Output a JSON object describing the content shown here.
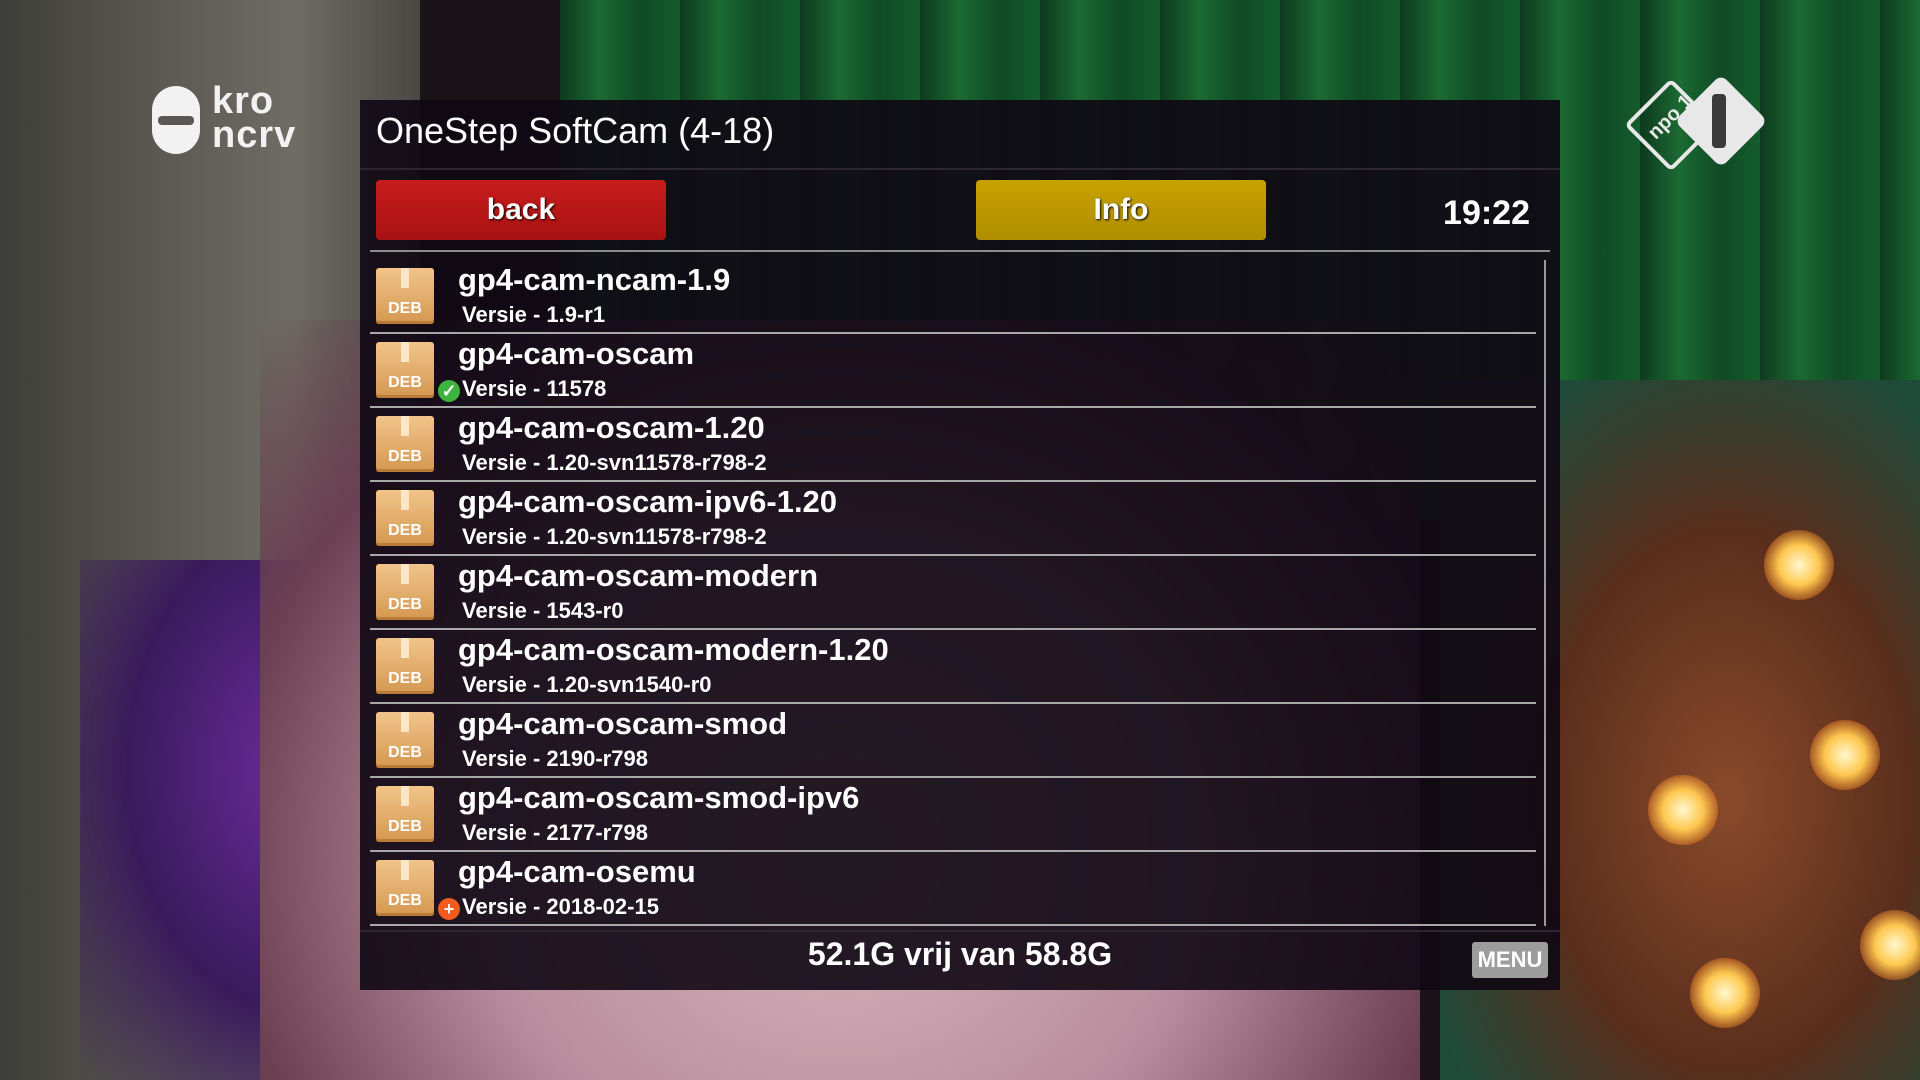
{
  "panel": {
    "title": "OneStep SoftCam (4-18)",
    "buttons": {
      "back": "back",
      "info": "Info"
    },
    "clock": "19:22"
  },
  "logos": {
    "channel_left": "kro ncrv",
    "channel_right": "npo 1"
  },
  "colors": {
    "back_button": "#c81c1c",
    "info_button": "#c7a200",
    "installed_status": "#3db43d",
    "add_status": "#f25a1e"
  },
  "packages": [
    {
      "icon": "deb-package-icon",
      "badge": "DEB",
      "name": "gp4-cam-ncam-1.9",
      "version": "Versie - 1.9-r1",
      "status": ""
    },
    {
      "icon": "deb-package-icon",
      "badge": "DEB",
      "name": "gp4-cam-oscam",
      "version": "Versie - 11578",
      "status": "installed"
    },
    {
      "icon": "deb-package-icon",
      "badge": "DEB",
      "name": "gp4-cam-oscam-1.20",
      "version": "Versie - 1.20-svn11578-r798-2",
      "status": ""
    },
    {
      "icon": "deb-package-icon",
      "badge": "DEB",
      "name": "gp4-cam-oscam-ipv6-1.20",
      "version": "Versie - 1.20-svn11578-r798-2",
      "status": ""
    },
    {
      "icon": "deb-package-icon",
      "badge": "DEB",
      "name": "gp4-cam-oscam-modern",
      "version": "Versie - 1543-r0",
      "status": ""
    },
    {
      "icon": "deb-package-icon",
      "badge": "DEB",
      "name": "gp4-cam-oscam-modern-1.20",
      "version": "Versie - 1.20-svn1540-r0",
      "status": ""
    },
    {
      "icon": "deb-package-icon",
      "badge": "DEB",
      "name": "gp4-cam-oscam-smod",
      "version": "Versie - 2190-r798",
      "status": ""
    },
    {
      "icon": "deb-package-icon",
      "badge": "DEB",
      "name": "gp4-cam-oscam-smod-ipv6",
      "version": "Versie - 2177-r798",
      "status": ""
    },
    {
      "icon": "deb-package-icon",
      "badge": "DEB",
      "name": "gp4-cam-osemu",
      "version": "Versie - 2018-02-15",
      "status": "add"
    }
  ],
  "footer": {
    "storage": "52.1G vrij van 58.8G",
    "menu_key": "MENU"
  }
}
